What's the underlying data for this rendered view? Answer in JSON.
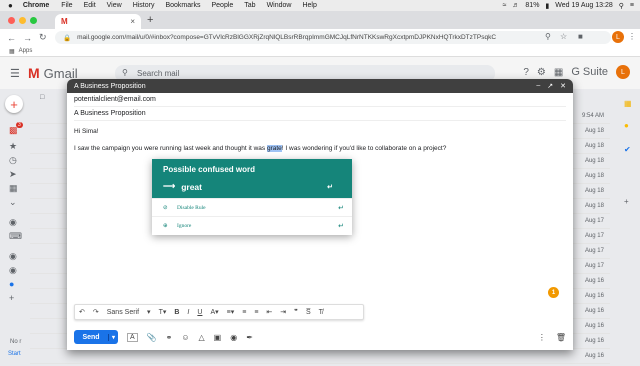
{
  "menubar": {
    "apple": "",
    "app": "Chrome",
    "items": [
      "File",
      "Edit",
      "View",
      "History",
      "Bookmarks",
      "People",
      "Tab",
      "Window",
      "Help"
    ],
    "battery": "81%",
    "datetime": "Wed 19 Aug  13:28"
  },
  "browser": {
    "tab_title": "M",
    "tab_close": "×",
    "new_tab": "+",
    "url": "mail.google.com/mail/u/0/#inbox?compose=GTvVlcRzBlGGXRjZrqNlQLBsrRBrqpImmGMCJqLfNrNTKKswRgXcxtpmDJPKNxHQTrkxDTzTPsqkC",
    "bookmarks": "Apps",
    "avatar": "L"
  },
  "gmail": {
    "product": "Gmail",
    "search_placeholder": "Search mail",
    "gsuite": "G Suite",
    "avatar": "L",
    "inbox_badge": "3"
  },
  "inbox": {
    "dates": [
      "9:54 AM",
      "Aug 18",
      "Aug 18",
      "Aug 18",
      "Aug 18",
      "Aug 18",
      "Aug 18",
      "Aug 17",
      "Aug 17",
      "Aug 17",
      "Aug 17",
      "Aug 16",
      "Aug 16",
      "Aug 16",
      "Aug 16",
      "Aug 16",
      "Aug 16",
      "Aug 15"
    ]
  },
  "sidebar_bottom": {
    "line1": "No r",
    "line2": "Start"
  },
  "compose": {
    "title": "A Business Proposition",
    "to": "potentialclient@email.com",
    "subject": "A Business Proposition",
    "greeting": "Hi Sima!",
    "body_before": "I saw the campaign you were running last week and thought it was ",
    "highlight": "grate",
    "body_after": "! I was wondering if you'd like to collaborate on a project?",
    "send": "Send",
    "font": "Sans Serif"
  },
  "popup": {
    "title": "Possible confused word",
    "suggestion": "great",
    "action1": "Disable Rule",
    "action2": "Ignore"
  },
  "grammar_badge": "1",
  "colors": {
    "popup": "#15857a",
    "send": "#1a73e8",
    "compose_header": "#404040"
  }
}
